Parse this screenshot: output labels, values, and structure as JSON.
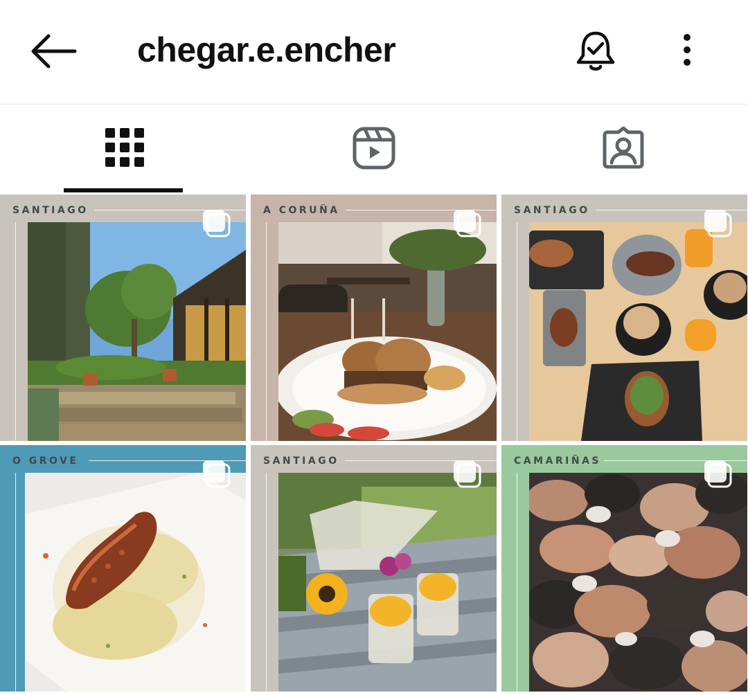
{
  "header": {
    "title": "chegar.e.encher",
    "back_icon": "arrow-left-icon",
    "bell_icon": "bell-check-icon",
    "more_icon": "more-vertical-icon"
  },
  "tabs": [
    {
      "name": "posts",
      "icon": "grid-icon",
      "active": true
    },
    {
      "name": "reels",
      "icon": "reels-icon",
      "active": false
    },
    {
      "name": "tagged",
      "icon": "tagged-person-icon",
      "active": false
    }
  ],
  "posts": [
    {
      "location": "SANTIAGO",
      "frame_color": "#c9c4bb",
      "subject": "garden patio",
      "multi": true
    },
    {
      "location": "A CORUÑA",
      "frame_color": "#c8b4a9",
      "subject": "burger plate",
      "multi": true
    },
    {
      "location": "SANTIAGO",
      "frame_color": "#c9c4bb",
      "subject": "coffee breakfast table",
      "multi": true
    },
    {
      "location": "O GROVE",
      "frame_color": "#4f9ab7",
      "subject": "octopus dish",
      "multi": true
    },
    {
      "location": "SANTIAGO",
      "frame_color": "#c9c4bb",
      "subject": "dessert jars with sunflowers",
      "multi": true
    },
    {
      "location": "CAMARIÑAS",
      "frame_color": "#9bc99e",
      "subject": "percebes barnacles",
      "multi": true
    }
  ],
  "colors": {
    "text": "#111111",
    "tab_inactive": "#5f6468",
    "tag_text": "#3f4a4a"
  }
}
